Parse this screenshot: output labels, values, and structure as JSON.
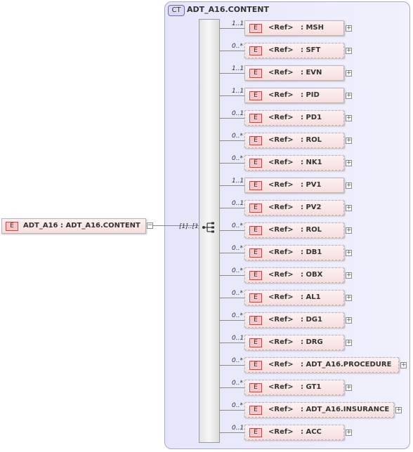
{
  "complex_type": {
    "badge": "CT",
    "title": "ADT_A16.CONTENT"
  },
  "root": {
    "badge": "E",
    "label": "ADT_A16 : ADT_A16.CONTENT",
    "collapse_symbol": "−"
  },
  "sequence": {
    "multiplicity": "[1]..[1]",
    "icon": "sequence-icon"
  },
  "elements": [
    {
      "multiplicity": "1..1",
      "badge": "E",
      "ref": "<Ref>",
      "name": ": MSH",
      "optional": false,
      "expand": "+"
    },
    {
      "multiplicity": "0..*",
      "badge": "E",
      "ref": "<Ref>",
      "name": ": SFT",
      "optional": true,
      "expand": "+"
    },
    {
      "multiplicity": "1..1",
      "badge": "E",
      "ref": "<Ref>",
      "name": ": EVN",
      "optional": false,
      "expand": "+"
    },
    {
      "multiplicity": "1..1",
      "badge": "E",
      "ref": "<Ref>",
      "name": ": PID",
      "optional": false,
      "expand": "+"
    },
    {
      "multiplicity": "0..1",
      "badge": "E",
      "ref": "<Ref>",
      "name": ": PD1",
      "optional": true,
      "expand": "+"
    },
    {
      "multiplicity": "0..*",
      "badge": "E",
      "ref": "<Ref>",
      "name": ": ROL",
      "optional": true,
      "expand": "+"
    },
    {
      "multiplicity": "0..*",
      "badge": "E",
      "ref": "<Ref>",
      "name": ": NK1",
      "optional": true,
      "expand": "+"
    },
    {
      "multiplicity": "1..1",
      "badge": "E",
      "ref": "<Ref>",
      "name": ": PV1",
      "optional": false,
      "expand": "+"
    },
    {
      "multiplicity": "0..1",
      "badge": "E",
      "ref": "<Ref>",
      "name": ": PV2",
      "optional": true,
      "expand": "+"
    },
    {
      "multiplicity": "0..*",
      "badge": "E",
      "ref": "<Ref>",
      "name": ": ROL",
      "optional": true,
      "expand": "+"
    },
    {
      "multiplicity": "0..*",
      "badge": "E",
      "ref": "<Ref>",
      "name": ": DB1",
      "optional": true,
      "expand": "+"
    },
    {
      "multiplicity": "0..*",
      "badge": "E",
      "ref": "<Ref>",
      "name": ": OBX",
      "optional": true,
      "expand": "+"
    },
    {
      "multiplicity": "0..*",
      "badge": "E",
      "ref": "<Ref>",
      "name": ": AL1",
      "optional": true,
      "expand": "+"
    },
    {
      "multiplicity": "0..*",
      "badge": "E",
      "ref": "<Ref>",
      "name": ": DG1",
      "optional": true,
      "expand": "+"
    },
    {
      "multiplicity": "0..1",
      "badge": "E",
      "ref": "<Ref>",
      "name": ": DRG",
      "optional": true,
      "expand": "+"
    },
    {
      "multiplicity": "0..*",
      "badge": "E",
      "ref": "<Ref>",
      "name": ": ADT_A16.PROCEDURE",
      "optional": true,
      "expand": "+"
    },
    {
      "multiplicity": "0..*",
      "badge": "E",
      "ref": "<Ref>",
      "name": ": GT1",
      "optional": true,
      "expand": "+"
    },
    {
      "multiplicity": "0..*",
      "badge": "E",
      "ref": "<Ref>",
      "name": ": ADT_A16.INSURANCE",
      "optional": true,
      "expand": "+"
    },
    {
      "multiplicity": "0..1",
      "badge": "E",
      "ref": "<Ref>",
      "name": ": ACC",
      "optional": true,
      "expand": "+"
    }
  ]
}
